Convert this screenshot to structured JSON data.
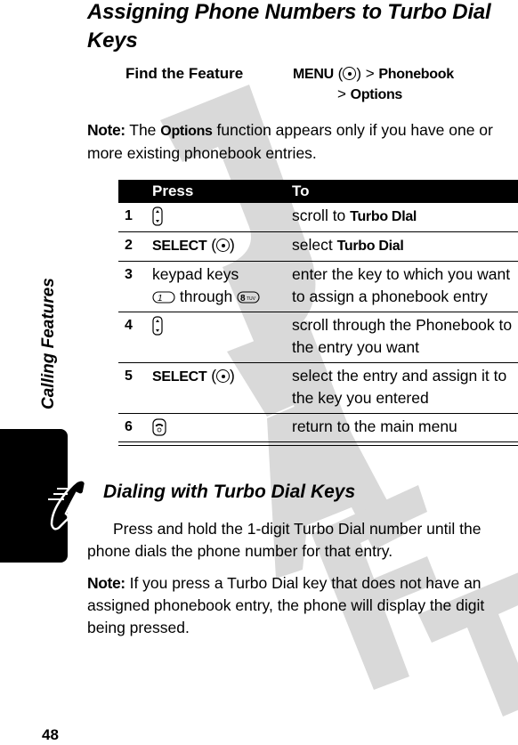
{
  "side_tab": {
    "section_label": "Calling Features",
    "icon": "phone-handset-icon"
  },
  "page_number": "48",
  "watermark_text": "DRAFT",
  "section1": {
    "title": "Assigning Phone Numbers to Turbo Dial Keys",
    "find_feature": {
      "label": "Find the Feature",
      "menu_key": "MENU",
      "center_key_icon": "center-select-key-icon",
      "separator": ">",
      "path": [
        "Phonebook",
        "Options"
      ]
    },
    "note": {
      "label": "Note:",
      "text_before": " The ",
      "term": "Options",
      "text_after": " function appears only if you have one or more existing phonebook entries."
    },
    "table": {
      "headers": [
        "",
        "Press",
        "To"
      ],
      "rows": [
        {
          "num": "1",
          "press_icon": "nav-scroll-key-icon",
          "press_text": "",
          "to_text": "scroll to ",
          "to_term": "Turbo Dlal",
          "to_after": ""
        },
        {
          "num": "2",
          "press_key": "SELECT",
          "press_icon": "center-select-key-icon",
          "to_text": "select ",
          "to_term": "Turbo Dial",
          "to_after": ""
        },
        {
          "num": "3",
          "press_text": "keypad keys",
          "press_from_key": "1",
          "press_through": "through",
          "press_to_key": "8",
          "press_to_key_letters": "TUV",
          "to_text": "enter the key to which you want to assign a phonebook entry",
          "to_term": "",
          "to_after": ""
        },
        {
          "num": "4",
          "press_icon": "nav-scroll-key-icon",
          "to_text": "scroll through the Phonebook to the entry you want",
          "to_term": "",
          "to_after": ""
        },
        {
          "num": "5",
          "press_key": "SELECT",
          "press_icon": "center-select-key-icon",
          "to_text": "select the entry and assign it to the key you entered",
          "to_term": "",
          "to_after": ""
        },
        {
          "num": "6",
          "press_icon": "end-key-icon",
          "to_text": "return to the main menu",
          "to_term": "",
          "to_after": ""
        }
      ]
    }
  },
  "section2": {
    "title": "Dialing with Turbo Dial Keys",
    "paragraph": "Press and hold the 1-digit Turbo Dial number until the phone dials the phone number for that entry.",
    "note": {
      "label": "Note:",
      "text": " If you press a Turbo Dial key that does not have an assigned phonebook entry, the phone will display the digit being pressed."
    }
  }
}
